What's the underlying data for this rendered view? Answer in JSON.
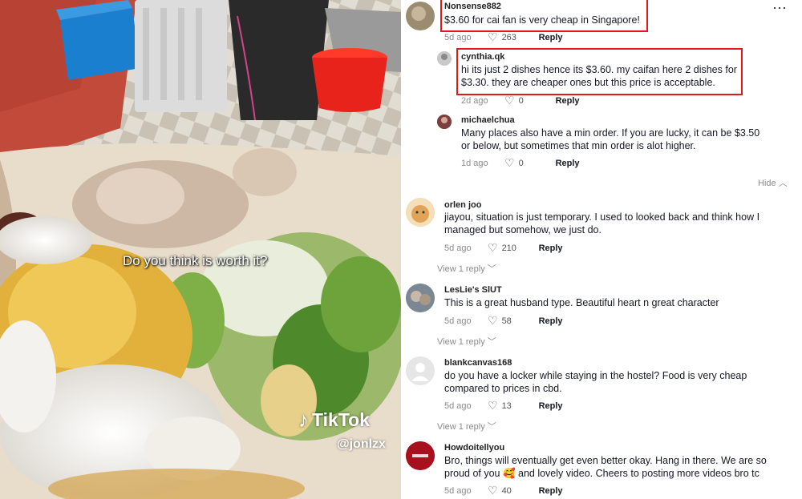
{
  "video": {
    "caption": "Do you think is worth it?",
    "logo_text": "TikTok",
    "handle": "@jonlzx",
    "logo_icon": "tiktok-note-icon"
  },
  "menu_icon": "⋯",
  "hide_label": "Hide",
  "comments": [
    {
      "user": "Nonsense882",
      "text": "$3.60 for cai fan is very cheap in Singapore!",
      "date": "5d ago",
      "likes": "263",
      "reply": "Reply"
    },
    {
      "user": "cynthia.qk",
      "text": "hi its just 2 dishes hence its $3.60. my caifan here 2 dishes for $3.30. they are cheaper ones but this price is acceptable.",
      "date": "2d ago",
      "likes": "0",
      "reply": "Reply"
    },
    {
      "user": "michaelchua",
      "text": "Many places also have a min order. If you are lucky, it can be $3.50 or below, but sometimes that min order is alot higher.",
      "date": "1d ago",
      "likes": "0",
      "reply": "Reply"
    },
    {
      "user": "orlen joo",
      "text": "jiayou, situation is just temporary. I used to looked back and think how I managed but somehow, we just do.",
      "date": "5d ago",
      "likes": "210",
      "reply": "Reply",
      "view": "View 1 reply"
    },
    {
      "user": "LesLie's SlUT",
      "text": "This is a great husband type. Beautiful heart n great character",
      "date": "5d ago",
      "likes": "58",
      "reply": "Reply",
      "view": "View 1 reply"
    },
    {
      "user": "blankcanvas168",
      "text": "do you have a locker while staying in the hostel? Food is very cheap compared to prices in cbd.",
      "date": "5d ago",
      "likes": "13",
      "reply": "Reply",
      "view": "View 1 reply"
    },
    {
      "user": "Howdoitellyou",
      "text": "Bro, things will eventually get even better okay. Hang in there. We are so proud of you 🥰 and lovely video. Cheers to posting more videos bro tc",
      "date": "5d ago",
      "likes": "40",
      "reply": "Reply"
    }
  ],
  "colors": {
    "highlight": "#e01a1a",
    "muted": "#8a8b91",
    "text": "#161823"
  }
}
